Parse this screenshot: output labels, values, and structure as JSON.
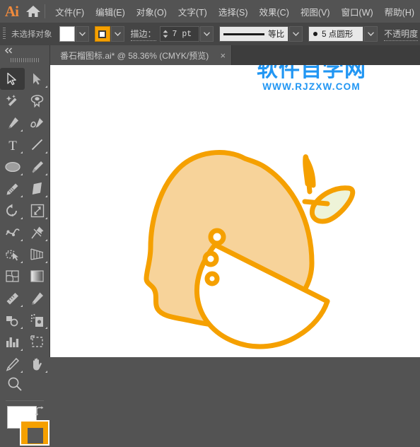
{
  "app": {
    "name": "Ai",
    "logo_color": "#f08a3c"
  },
  "menubar": {
    "home_icon": "home-icon",
    "items": [
      {
        "label": "文件(F)",
        "name": "menu-file"
      },
      {
        "label": "编辑(E)",
        "name": "menu-edit"
      },
      {
        "label": "对象(O)",
        "name": "menu-object"
      },
      {
        "label": "文字(T)",
        "name": "menu-type"
      },
      {
        "label": "选择(S)",
        "name": "menu-select"
      },
      {
        "label": "效果(C)",
        "name": "menu-effect"
      },
      {
        "label": "视图(V)",
        "name": "menu-view"
      },
      {
        "label": "窗口(W)",
        "name": "menu-window"
      },
      {
        "label": "帮助(H)",
        "name": "menu-help"
      }
    ]
  },
  "controlbar": {
    "selection_status": "未选择对象",
    "fill_color": "#ffffff",
    "stroke_color": "#f5a000",
    "stroke_label": "描边：",
    "stroke_weight": "7 pt",
    "profile_label": "等比",
    "brush_label": "5 点圆形",
    "opacity_label": "不透明度"
  },
  "toolbox": {
    "collapse_icon": "double-chevron-left-icon",
    "tools": [
      {
        "name": "selection-tool",
        "icon": "arrow-cursor-icon",
        "active": true,
        "has_flyout": false
      },
      {
        "name": "direct-selection-tool",
        "icon": "white-arrow-icon",
        "active": false,
        "has_flyout": true
      },
      {
        "name": "magic-wand-tool",
        "icon": "magic-wand-icon",
        "active": false,
        "has_flyout": false
      },
      {
        "name": "lasso-tool",
        "icon": "lasso-icon",
        "active": false,
        "has_flyout": false
      },
      {
        "name": "pen-tool",
        "icon": "pen-icon",
        "active": false,
        "has_flyout": true
      },
      {
        "name": "curvature-tool",
        "icon": "curvature-icon",
        "active": false,
        "has_flyout": false
      },
      {
        "name": "type-tool",
        "icon": "type-t-icon",
        "active": false,
        "has_flyout": true
      },
      {
        "name": "line-segment-tool",
        "icon": "line-segment-icon",
        "active": false,
        "has_flyout": true
      },
      {
        "name": "ellipse-tool",
        "icon": "ellipse-icon",
        "active": false,
        "has_flyout": true
      },
      {
        "name": "paintbrush-tool",
        "icon": "paintbrush-icon",
        "active": false,
        "has_flyout": true
      },
      {
        "name": "shaper-tool",
        "icon": "shaper-pencil-icon",
        "active": false,
        "has_flyout": true
      },
      {
        "name": "eraser-tool",
        "icon": "eraser-icon",
        "active": false,
        "has_flyout": true
      },
      {
        "name": "rotate-tool",
        "icon": "rotate-icon",
        "active": false,
        "has_flyout": true
      },
      {
        "name": "scale-tool",
        "icon": "scale-icon",
        "active": false,
        "has_flyout": true
      },
      {
        "name": "width-tool",
        "icon": "width-warp-icon",
        "active": false,
        "has_flyout": true
      },
      {
        "name": "free-transform-tool",
        "icon": "pushpin-icon",
        "active": false,
        "has_flyout": true
      },
      {
        "name": "shape-builder-tool",
        "icon": "shape-builder-icon",
        "active": false,
        "has_flyout": true
      },
      {
        "name": "perspective-grid-tool",
        "icon": "perspective-grid-icon",
        "active": false,
        "has_flyout": true
      },
      {
        "name": "mesh-tool",
        "icon": "mesh-icon",
        "active": false,
        "has_flyout": false
      },
      {
        "name": "gradient-tool",
        "icon": "gradient-icon",
        "active": false,
        "has_flyout": false
      },
      {
        "name": "eyedropper-tool",
        "icon": "eyedropper-ruler-icon",
        "active": false,
        "has_flyout": true
      },
      {
        "name": "blend-tool",
        "icon": "blend-pen-icon",
        "active": false,
        "has_flyout": false
      },
      {
        "name": "symbol-sprayer-tool",
        "icon": "symbol-sprayer-icon",
        "active": false,
        "has_flyout": true
      },
      {
        "name": "column-graph-tool",
        "icon": "bar-graph-icon",
        "active": false,
        "has_flyout": true
      },
      {
        "name": "artboard-tool",
        "icon": "artboard-icon",
        "active": false,
        "has_flyout": false
      },
      {
        "name": "slice-tool",
        "icon": "slice-knife-icon",
        "active": false,
        "has_flyout": true
      },
      {
        "name": "hand-tool",
        "icon": "hand-icon",
        "active": false,
        "has_flyout": true
      },
      {
        "name": "zoom-tool",
        "icon": "magnifier-icon",
        "active": false,
        "has_flyout": false
      }
    ],
    "fill_swatch_color": "#ffffff",
    "stroke_swatch_color": "#f5a000",
    "swap_icon": "swap-fill-stroke-icon"
  },
  "document": {
    "tab_title": "番石榴图标.ai* @ 58.36% (CMYK/预览)",
    "close_label": "×"
  },
  "watermark": {
    "main": "软件自学网",
    "sub": "WWW.RJZXW.COM",
    "color": "#2196f3"
  },
  "artwork": {
    "name": "guava-fruit-icon",
    "stroke_color": "#f5a000",
    "body_fill": "#f7d39a",
    "flesh_fill": "#ffffff",
    "leaf_fill": "#eef3d8",
    "stroke_width": 7
  }
}
